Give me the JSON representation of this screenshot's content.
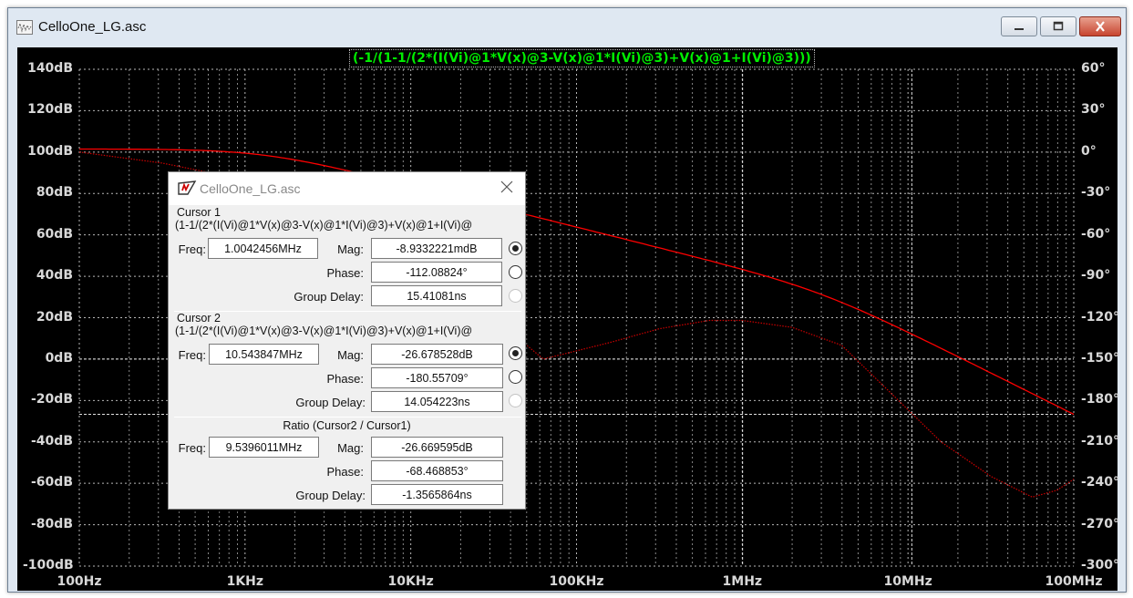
{
  "window": {
    "title": "CelloOne_LG.asc",
    "buttons": {
      "minimize": "minimize-icon",
      "maximize": "maximize-icon",
      "close": "close-icon"
    }
  },
  "plot": {
    "trace_expression": "(-1/(1-1/(2*(I(Vi)@1*V(x)@3-V(x)@1*I(Vi)@3)+V(x)@1+I(Vi)@3)))",
    "left_axis_labels": [
      "140dB",
      "120dB",
      "100dB",
      "80dB",
      "60dB",
      "40dB",
      "20dB",
      "0dB",
      "-20dB",
      "-40dB",
      "-60dB",
      "-80dB",
      "-100dB"
    ],
    "right_axis_labels": [
      "60°",
      "30°",
      "0°",
      "-30°",
      "-60°",
      "-90°",
      "-120°",
      "-150°",
      "-180°",
      "-210°",
      "-240°",
      "-270°",
      "-300°"
    ],
    "x_axis_labels": [
      "100Hz",
      "1KHz",
      "10KHz",
      "100KHz",
      "1MHz",
      "10MHz",
      "100MHz"
    ],
    "colors": {
      "background": "#000000",
      "grid": "#b8b8b8",
      "magnitude": "#ff0000",
      "phase": "#cc0000",
      "title": "#00ee00"
    }
  },
  "dialog": {
    "title": "CelloOne_LG.asc",
    "cursor1": {
      "label": "Cursor 1",
      "expression": "(1-1/(2*(I(Vi)@1*V(x)@3-V(x)@1*I(Vi)@3)+V(x)@1+I(Vi)@",
      "freq_label": "Freq:",
      "freq": "1.0042456MHz",
      "mag_label": "Mag:",
      "mag": "-8.9332221mdB",
      "phase_label": "Phase:",
      "phase": "-112.08824°",
      "group_delay_label": "Group Delay:",
      "group_delay": "15.41081ns"
    },
    "cursor2": {
      "label": "Cursor 2",
      "expression": "(1-1/(2*(I(Vi)@1*V(x)@3-V(x)@1*I(Vi)@3)+V(x)@1+I(Vi)@",
      "freq_label": "Freq:",
      "freq": "10.543847MHz",
      "mag_label": "Mag:",
      "mag": "-26.678528dB",
      "phase_label": "Phase:",
      "phase": "-180.55709°",
      "group_delay_label": "Group Delay:",
      "group_delay": "14.054223ns"
    },
    "ratio": {
      "label": "Ratio (Cursor2 / Cursor1)",
      "freq_label": "Freq:",
      "freq": "9.5396011MHz",
      "mag_label": "Mag:",
      "mag": "-26.669595dB",
      "phase_label": "Phase:",
      "phase": "-68.468853°",
      "group_delay_label": "Group Delay:",
      "group_delay": "-1.3565864ns"
    }
  }
}
